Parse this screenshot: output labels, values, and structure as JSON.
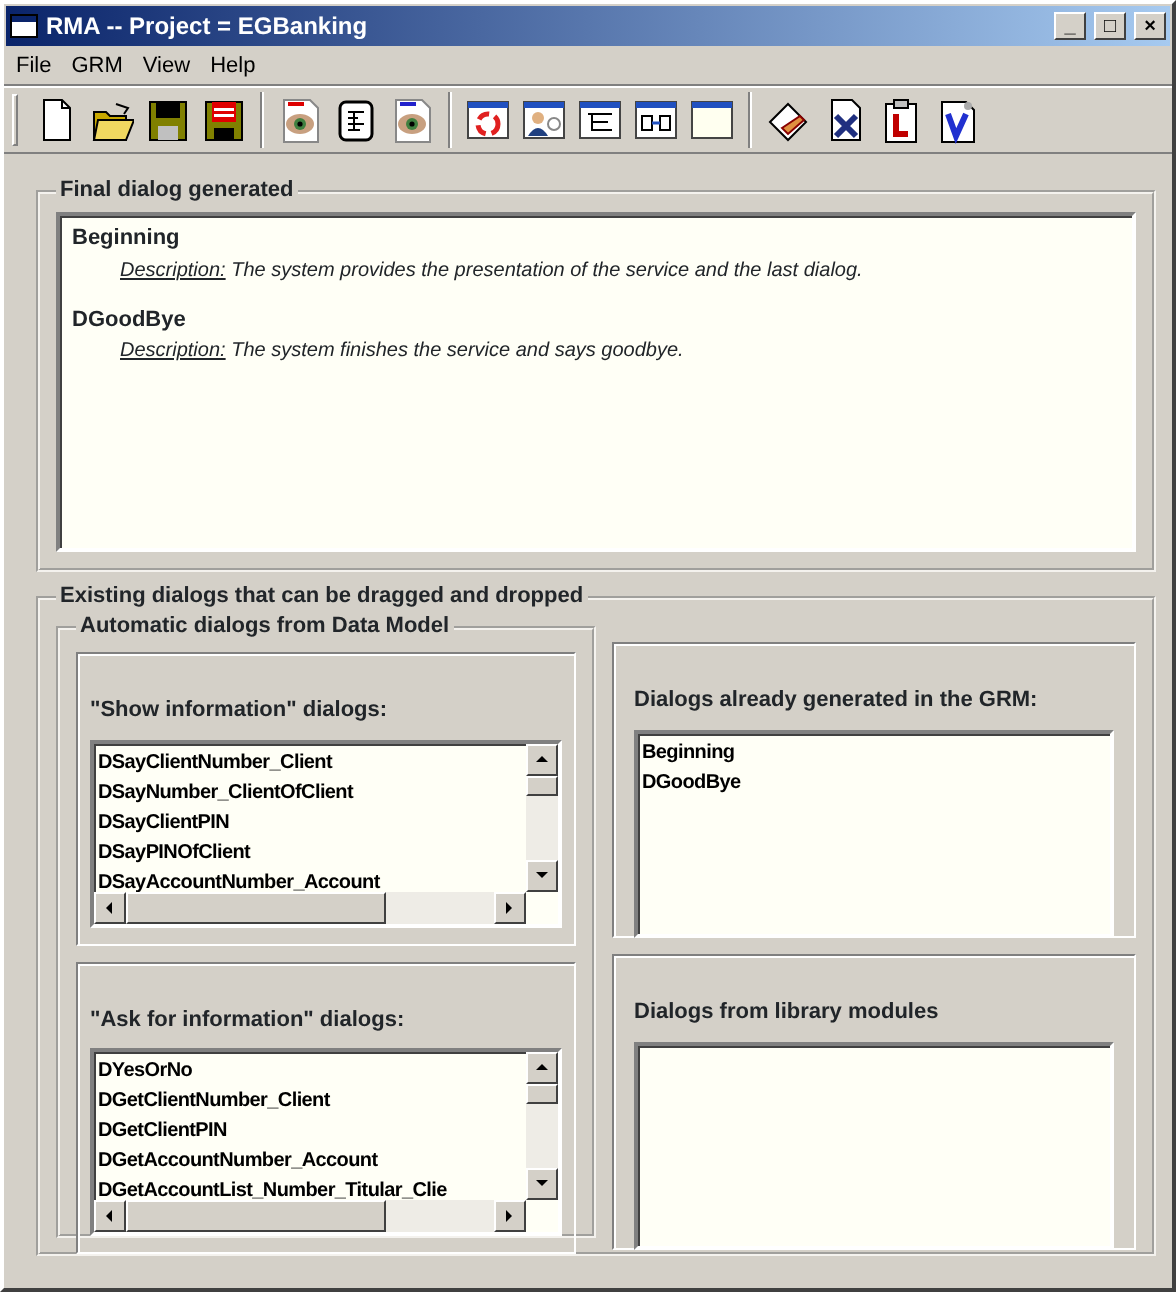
{
  "window": {
    "title": "RMA -- Project = EGBanking",
    "controls": [
      "_",
      "□",
      "×"
    ]
  },
  "menu": [
    "File",
    "GRM",
    "View",
    "Help"
  ],
  "final_dialog": {
    "legend": "Final dialog generated",
    "entries": [
      {
        "name": "Beginning",
        "description_label": "Description:",
        "description": "The system provides the presentation of the service and the last dialog."
      },
      {
        "name": "DGoodBye",
        "description_label": "Description:",
        "description": "The system finishes the service and says goodbye."
      }
    ]
  },
  "existing": {
    "legend": "Existing dialogs that can be dragged and dropped",
    "automatic": {
      "legend": "Automatic dialogs from Data Model",
      "lists": [
        {
          "title": "\"Show information\" dialogs:",
          "items": [
            "DSayClientNumber_Client",
            "DSayNumber_ClientOfClient",
            "DSayClientPIN",
            "DSayPINOfClient",
            "DSayAccountNumber_Account"
          ]
        },
        {
          "title": "\"Ask for information\" dialogs:",
          "items": [
            "DYesOrNo",
            "DGetClientNumber_Client",
            "DGetClientPIN",
            "DGetAccountNumber_Account",
            "DGetAccountList_Number_Titular_Clie"
          ]
        }
      ]
    },
    "other_lists": [
      {
        "title": "Dialogs already generated in the GRM:",
        "items": [
          "Beginning",
          "DGoodBye"
        ]
      },
      {
        "title": "Dialogs from library modules"
      }
    ]
  }
}
